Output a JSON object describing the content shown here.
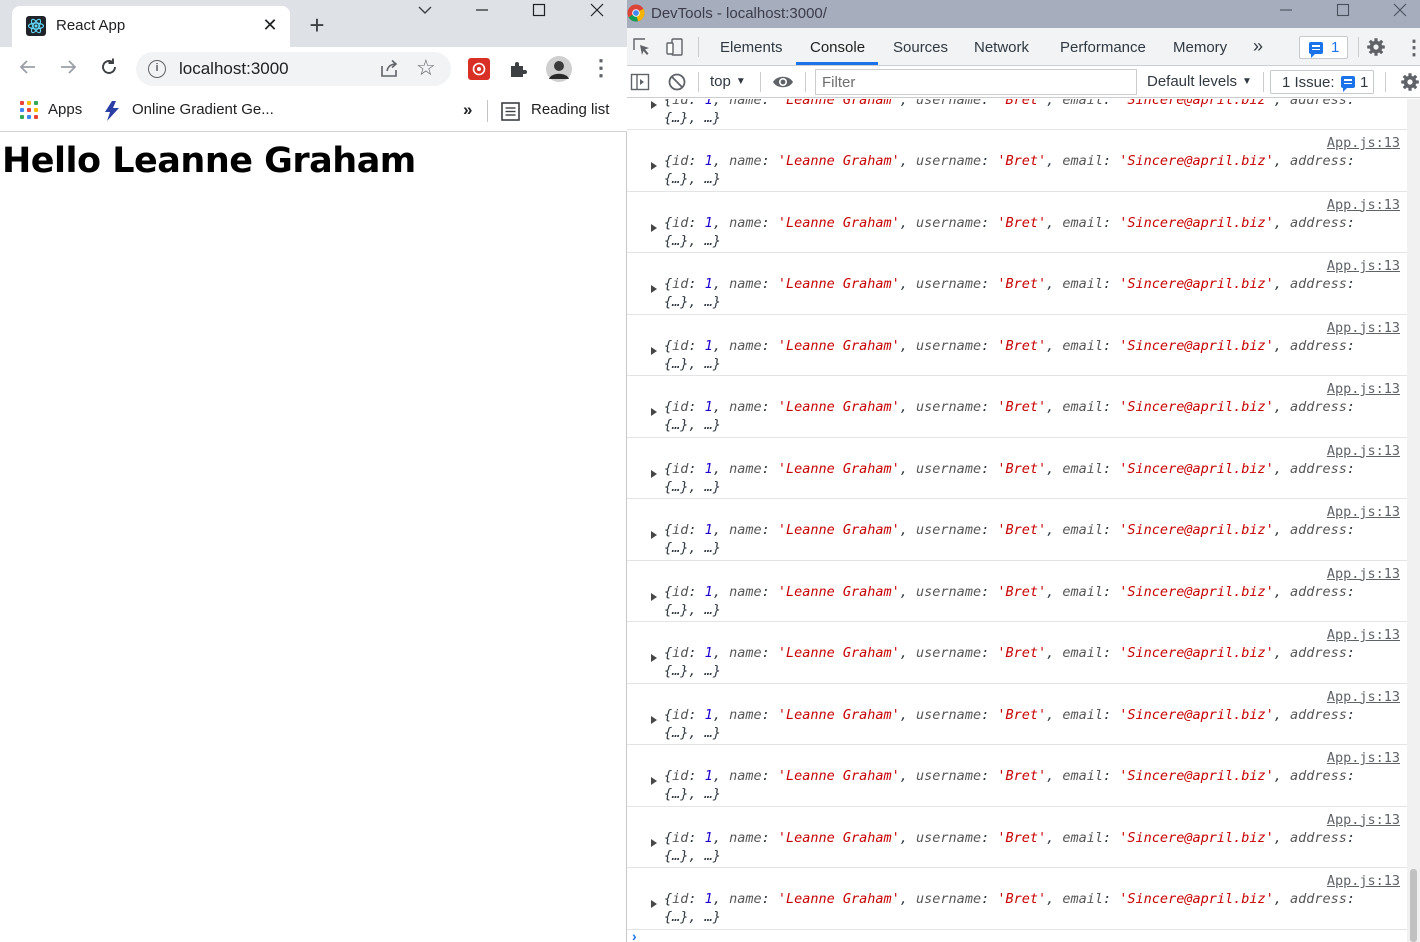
{
  "browser": {
    "tab_title": "React App",
    "new_tab_label": "+",
    "address": "localhost:3000",
    "bookmarks": {
      "apps_label": "Apps",
      "gradient_label": "Online Gradient Ge...",
      "overflow_label": "»",
      "reading_list_label": "Reading list"
    },
    "page_heading": "Hello Leanne Graham"
  },
  "devtools": {
    "window_title": "DevTools - localhost:3000/",
    "tabs": [
      {
        "label": "Elements",
        "active": false
      },
      {
        "label": "Console",
        "active": true
      },
      {
        "label": "Sources",
        "active": false
      },
      {
        "label": "Network",
        "active": false
      },
      {
        "label": "Performance",
        "active": false
      },
      {
        "label": "Memory",
        "active": false
      }
    ],
    "more_tabs_label": "»",
    "issues_badge_count": "1",
    "console_bar": {
      "context_label": "top",
      "filter_placeholder": "Filter",
      "levels_label": "Default levels",
      "issues_label": "1 Issue:",
      "issues_count": "1"
    },
    "log_entry": {
      "source": "App.js:13",
      "line1_parts": [
        {
          "t": "{",
          "c": ""
        },
        {
          "t": "id",
          "c": "k"
        },
        {
          "t": ": ",
          "c": ""
        },
        {
          "t": "1",
          "c": "num"
        },
        {
          "t": ", ",
          "c": ""
        },
        {
          "t": "name",
          "c": "k"
        },
        {
          "t": ": ",
          "c": ""
        },
        {
          "t": "'Leanne Graham'",
          "c": "str"
        },
        {
          "t": ", ",
          "c": ""
        },
        {
          "t": "username",
          "c": "k"
        },
        {
          "t": ": ",
          "c": ""
        },
        {
          "t": "'Bret'",
          "c": "str"
        },
        {
          "t": ", ",
          "c": ""
        },
        {
          "t": "email",
          "c": "k"
        },
        {
          "t": ": ",
          "c": ""
        },
        {
          "t": "'Sincere@april.biz'",
          "c": "str"
        },
        {
          "t": ", ",
          "c": ""
        },
        {
          "t": "address",
          "c": "k"
        },
        {
          "t": ":",
          "c": ""
        }
      ],
      "line2": "{…}, …}"
    },
    "log_count": 14,
    "prompt_symbol": "›"
  },
  "colors": {
    "accent": "#1a73e8",
    "string": "#c80000",
    "number": "#1c00cf",
    "tabstrip": "#dee1e6",
    "devtools_titlebar": "#a6adbd"
  },
  "icons": [
    "react-icon",
    "close-icon",
    "back-icon",
    "forward-icon",
    "reload-icon",
    "info-icon",
    "share-icon",
    "star-icon",
    "extension-icon",
    "puzzle-icon",
    "avatar",
    "more-vert-icon",
    "apps-grid-icon",
    "gradient-icon",
    "reading-list-icon",
    "chrome-icon",
    "inspect-icon",
    "device-toolbar-icon",
    "gear-icon",
    "sidebar-icon",
    "clear-icon",
    "eye-icon",
    "message-icon"
  ]
}
